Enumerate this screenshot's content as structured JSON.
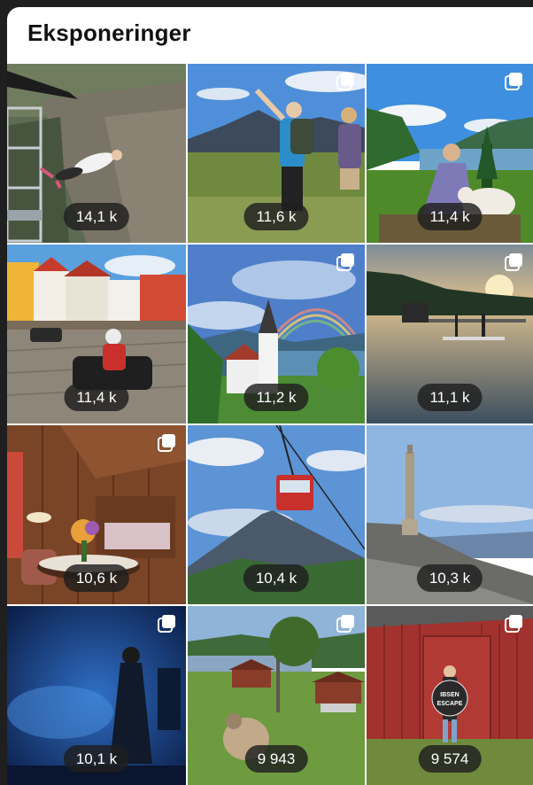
{
  "header": {
    "title": "Eksponeringer"
  },
  "tiles": [
    {
      "count": "14,1 k",
      "scene": "bungee-jump",
      "multi": false
    },
    {
      "count": "11,6 k",
      "scene": "mountain-hikers",
      "multi": true
    },
    {
      "count": "11,4 k",
      "scene": "fjord-woman-sheep",
      "multi": true
    },
    {
      "count": "11,4 k",
      "scene": "go-kart-town",
      "multi": false
    },
    {
      "count": "11,2 k",
      "scene": "church-rainbow",
      "multi": true
    },
    {
      "count": "11,1 k",
      "scene": "lake-paddleboard",
      "multi": true
    },
    {
      "count": "10,6 k",
      "scene": "wooden-interior",
      "multi": true
    },
    {
      "count": "10,4 k",
      "scene": "cable-car",
      "multi": false
    },
    {
      "count": "10,3 k",
      "scene": "mountain-tower",
      "multi": false
    },
    {
      "count": "10,1 k",
      "scene": "blue-stage-figure",
      "multi": true
    },
    {
      "count": "9 943",
      "scene": "farm-sheep",
      "multi": true
    },
    {
      "count": "9 574",
      "scene": "red-barn-sign",
      "multi": true
    }
  ],
  "sign_text": {
    "line1": "IBSEN",
    "line2": "ESCAPE"
  }
}
